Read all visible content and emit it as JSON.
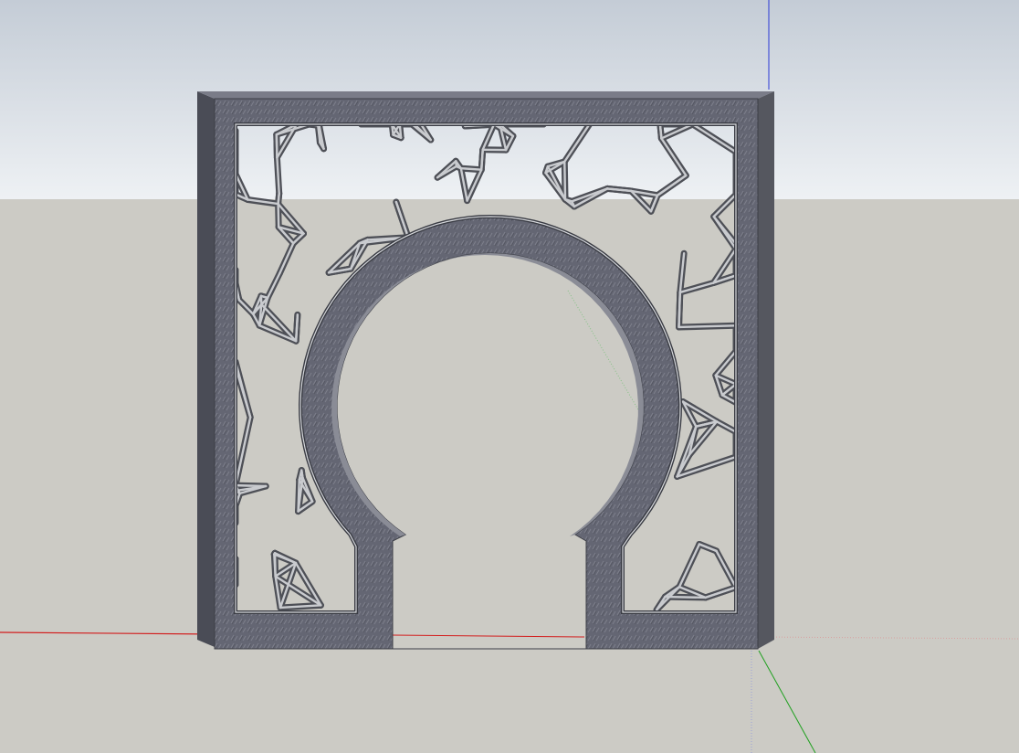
{
  "app": {
    "view": "perspective",
    "colors": {
      "sky_top": "#c4ccd6",
      "sky_bottom": "#eef1f4",
      "ground": "#cccbc5",
      "stone": "#646673",
      "stone_dark": "#4a4c56",
      "stone_top": "#7a7c88",
      "lattice": "#5a5c63",
      "lattice_light": "#c9cbcf",
      "axis_red": "#d21e1e",
      "axis_green": "#1fa01f",
      "axis_blue": "#2a38d6"
    }
  },
  "model": {
    "object": "moon-gate-screen",
    "parts": [
      "stone-frame",
      "arch-opening",
      "left-lattice-panel",
      "right-lattice-panel",
      "top-lattice-panel"
    ]
  },
  "axes": [
    "red-axis",
    "green-axis",
    "blue-axis"
  ]
}
